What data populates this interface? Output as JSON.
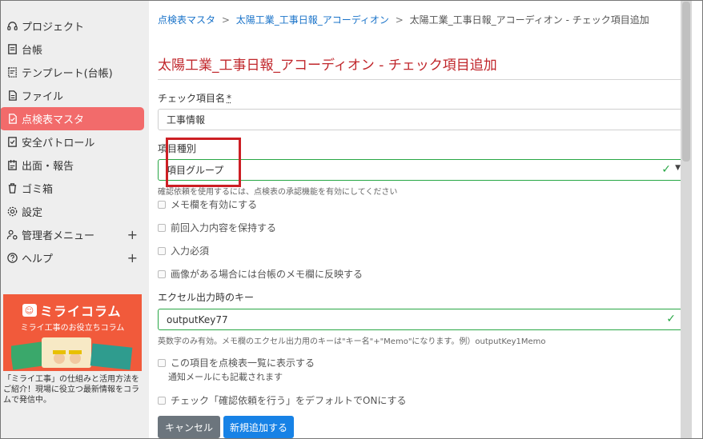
{
  "sidebar": {
    "items": [
      {
        "label": "プロジェクト",
        "icon": "headset-icon"
      },
      {
        "label": "台帳",
        "icon": "ledger-icon"
      },
      {
        "label": "テンプレート(台帳)",
        "icon": "template-icon"
      },
      {
        "label": "ファイル",
        "icon": "file-icon"
      },
      {
        "label": "点検表マスタ",
        "icon": "checklist-icon",
        "active": true
      },
      {
        "label": "安全パトロール",
        "icon": "safety-icon"
      },
      {
        "label": "出面・報告",
        "icon": "report-icon"
      },
      {
        "label": "ゴミ箱",
        "icon": "trash-icon"
      },
      {
        "label": "設定",
        "icon": "gear-icon"
      },
      {
        "label": "管理者メニュー",
        "icon": "admin-icon",
        "expand": "+"
      },
      {
        "label": "ヘルプ",
        "icon": "help-icon",
        "expand": "+"
      }
    ],
    "banner": {
      "logo": "ミライコラム",
      "subtitle": "ミライ工事のお役立ちコラム"
    },
    "description": "「ミライ工事」の仕組みと活用方法をご紹介！現場に役立つ最新情報をコラムで発信中。"
  },
  "breadcrumb": {
    "items": [
      "点検表マスタ",
      "太陽工業_工事日報_アコーディオン",
      "太陽工業_工事日報_アコーディオン - チェック項目追加"
    ],
    "separator": ">"
  },
  "page_title": "太陽工業_工事日報_アコーディオン - チェック項目追加",
  "form": {
    "name_label": "チェック項目名",
    "name_required": "*",
    "name_value": "工事情報",
    "type_label": "項目種別",
    "type_value": "項目グループ",
    "type_hint": "確認依頼を使用するには、点検表の承認機能を有効にしてください",
    "checkboxes": [
      "メモ欄を有効にする",
      "前回入力内容を保持する",
      "入力必須",
      "画像がある場合には台帳のメモ欄に反映する"
    ],
    "excel_key_label": "エクセル出力時のキー",
    "excel_key_value": "outputKey77",
    "excel_key_hint": "英数字のみ有効。メモ欄のエクセル出力用のキーは\"キー名\"+\"Memo\"になります。例）outputKey1Memo",
    "show_in_list_label": "この項目を点検表一覧に表示する",
    "show_in_list_note": "通知メールにも記載されます",
    "default_confirm_label": "チェック「確認依頼を行う」をデフォルトでONにする"
  },
  "buttons": {
    "cancel": "キャンセル",
    "submit": "新規追加する"
  },
  "colors": {
    "active_nav": "#f26b6b",
    "title": "#c0262b",
    "link": "#1a73c9",
    "valid": "#28a745",
    "highlight": "#cc1f24",
    "submit": "#1782e6",
    "cancel": "#6c757d"
  }
}
